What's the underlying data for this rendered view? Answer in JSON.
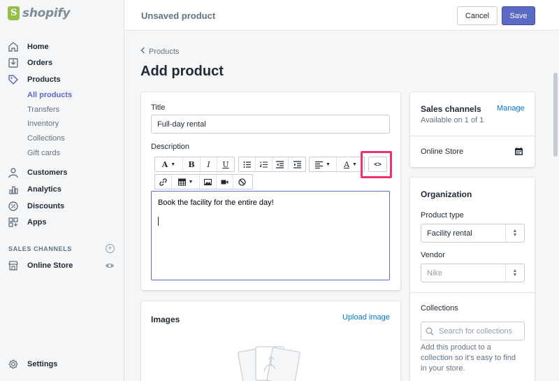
{
  "app": {
    "logo_text": "shopify"
  },
  "sidebar": {
    "items": [
      {
        "label": "Home",
        "icon": "home-icon"
      },
      {
        "label": "Orders",
        "icon": "orders-icon"
      },
      {
        "label": "Products",
        "icon": "tag-icon"
      },
      {
        "label": "Customers",
        "icon": "person-icon"
      },
      {
        "label": "Analytics",
        "icon": "bar-chart-icon"
      },
      {
        "label": "Discounts",
        "icon": "discount-icon"
      },
      {
        "label": "Apps",
        "icon": "apps-icon"
      }
    ],
    "product_subitems": [
      "All products",
      "Transfers",
      "Inventory",
      "Collections",
      "Gift cards"
    ],
    "sales_channels_header": "SALES CHANNELS",
    "online_store": "Online Store",
    "settings": "Settings"
  },
  "topbar": {
    "title": "Unsaved product",
    "cancel": "Cancel",
    "save": "Save"
  },
  "main": {
    "breadcrumb": "Products",
    "page_title": "Add product",
    "title_label": "Title",
    "title_value": "Full-day rental",
    "description_label": "Description",
    "description_text": "Book the facility for the entire day!",
    "toolbar": {
      "font": "A",
      "bold": "B",
      "italic": "I",
      "underline": "U",
      "color": "A",
      "html": "<>"
    },
    "images_title": "Images",
    "upload_image": "Upload image"
  },
  "side_panel": {
    "sales_channels_title": "Sales channels",
    "manage": "Manage",
    "available": "Available on 1 of 1",
    "online_store": "Online Store",
    "organization_title": "Organization",
    "product_type_label": "Product type",
    "product_type_value": "Facility rental",
    "vendor_label": "Vendor",
    "vendor_placeholder": "Nike",
    "collections_label": "Collections",
    "collections_placeholder": "Search for collections",
    "collections_help": [
      "Add this product to a",
      "collection so it's easy to find",
      "in your store."
    ]
  },
  "colors": {
    "accent": "#5c6ac4",
    "link": "#007ace",
    "highlight": "#e8336f",
    "brand": "#95bf47"
  }
}
